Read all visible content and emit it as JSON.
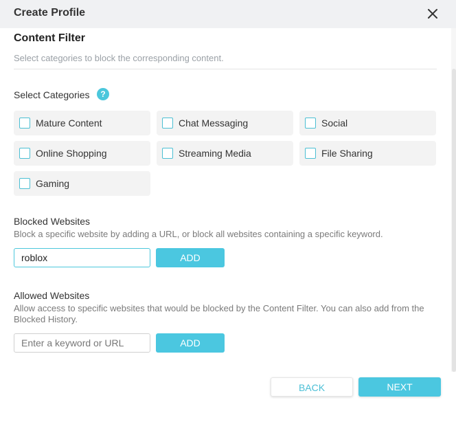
{
  "header": {
    "title": "Create Profile",
    "close_icon": "close-icon"
  },
  "content_filter": {
    "title": "Content Filter",
    "description": "Select categories to block the corresponding content.",
    "categories_label": "Select Categories",
    "help_icon_glyph": "?",
    "categories": [
      {
        "label": "Mature Content",
        "checked": false
      },
      {
        "label": "Chat Messaging",
        "checked": false
      },
      {
        "label": "Social",
        "checked": false
      },
      {
        "label": "Online Shopping",
        "checked": false
      },
      {
        "label": "Streaming Media",
        "checked": false
      },
      {
        "label": "File Sharing",
        "checked": false
      },
      {
        "label": "Gaming",
        "checked": false
      }
    ]
  },
  "blocked_websites": {
    "title": "Blocked Websites",
    "description": "Block a specific website by adding a URL, or block all websites containing a specific keyword.",
    "input_value": "roblox",
    "add_label": "ADD"
  },
  "allowed_websites": {
    "title": "Allowed Websites",
    "description": "Allow access to specific websites that would be blocked by the Content Filter. You can also add from the Blocked History.",
    "input_placeholder": "Enter a keyword or URL",
    "input_value": "",
    "add_label": "ADD"
  },
  "footer": {
    "back_label": "BACK",
    "next_label": "NEXT"
  },
  "colors": {
    "accent": "#4bc7e0",
    "header_bg": "#f0f1f3",
    "chip_bg": "#f3f3f3"
  }
}
